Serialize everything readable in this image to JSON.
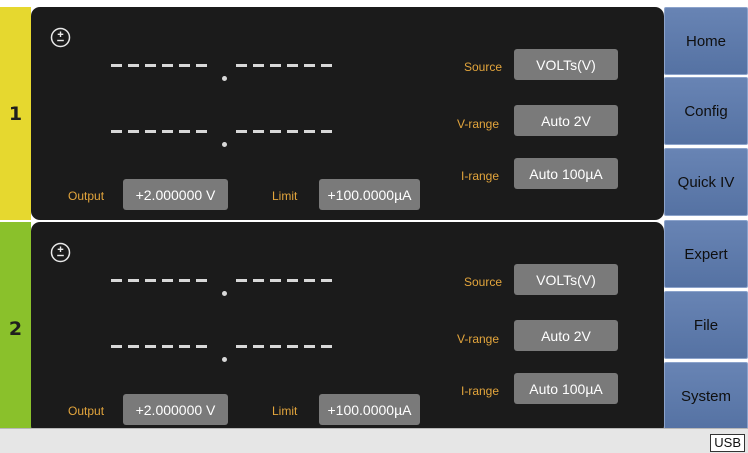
{
  "channels": [
    {
      "number": "1",
      "tab_color": "#e6d82f",
      "output_label": "Output",
      "output_value": "+2.000000 V",
      "limit_label": "Limit",
      "limit_value": "+100.0000µA",
      "source_label": "Source",
      "source_value": "VOLTs(V)",
      "vrange_label": "V-range",
      "vrange_value": "Auto 2V",
      "irange_label": "I-range",
      "irange_value": "Auto 100µA"
    },
    {
      "number": "2",
      "tab_color": "#8ac12b",
      "output_label": "Output",
      "output_value": "+2.000000 V",
      "limit_label": "Limit",
      "limit_value": "+100.0000µA",
      "source_label": "Source",
      "source_value": "VOLTs(V)",
      "vrange_label": "V-range",
      "vrange_value": "Auto 2V",
      "irange_label": "I-range",
      "irange_value": "Auto 100µA"
    }
  ],
  "menu": {
    "items": [
      "Home",
      "Config",
      "Quick IV",
      "Expert",
      "File",
      "System"
    ]
  },
  "status": {
    "usb": "USB"
  },
  "colors": {
    "screen_bg": "#1b1b1b",
    "label_orange": "#e3a53c",
    "field_gray": "#7a7a7a",
    "menu_blue": "#5f7cae"
  },
  "icons": {
    "polarity": "plus-minus-circle-icon"
  }
}
